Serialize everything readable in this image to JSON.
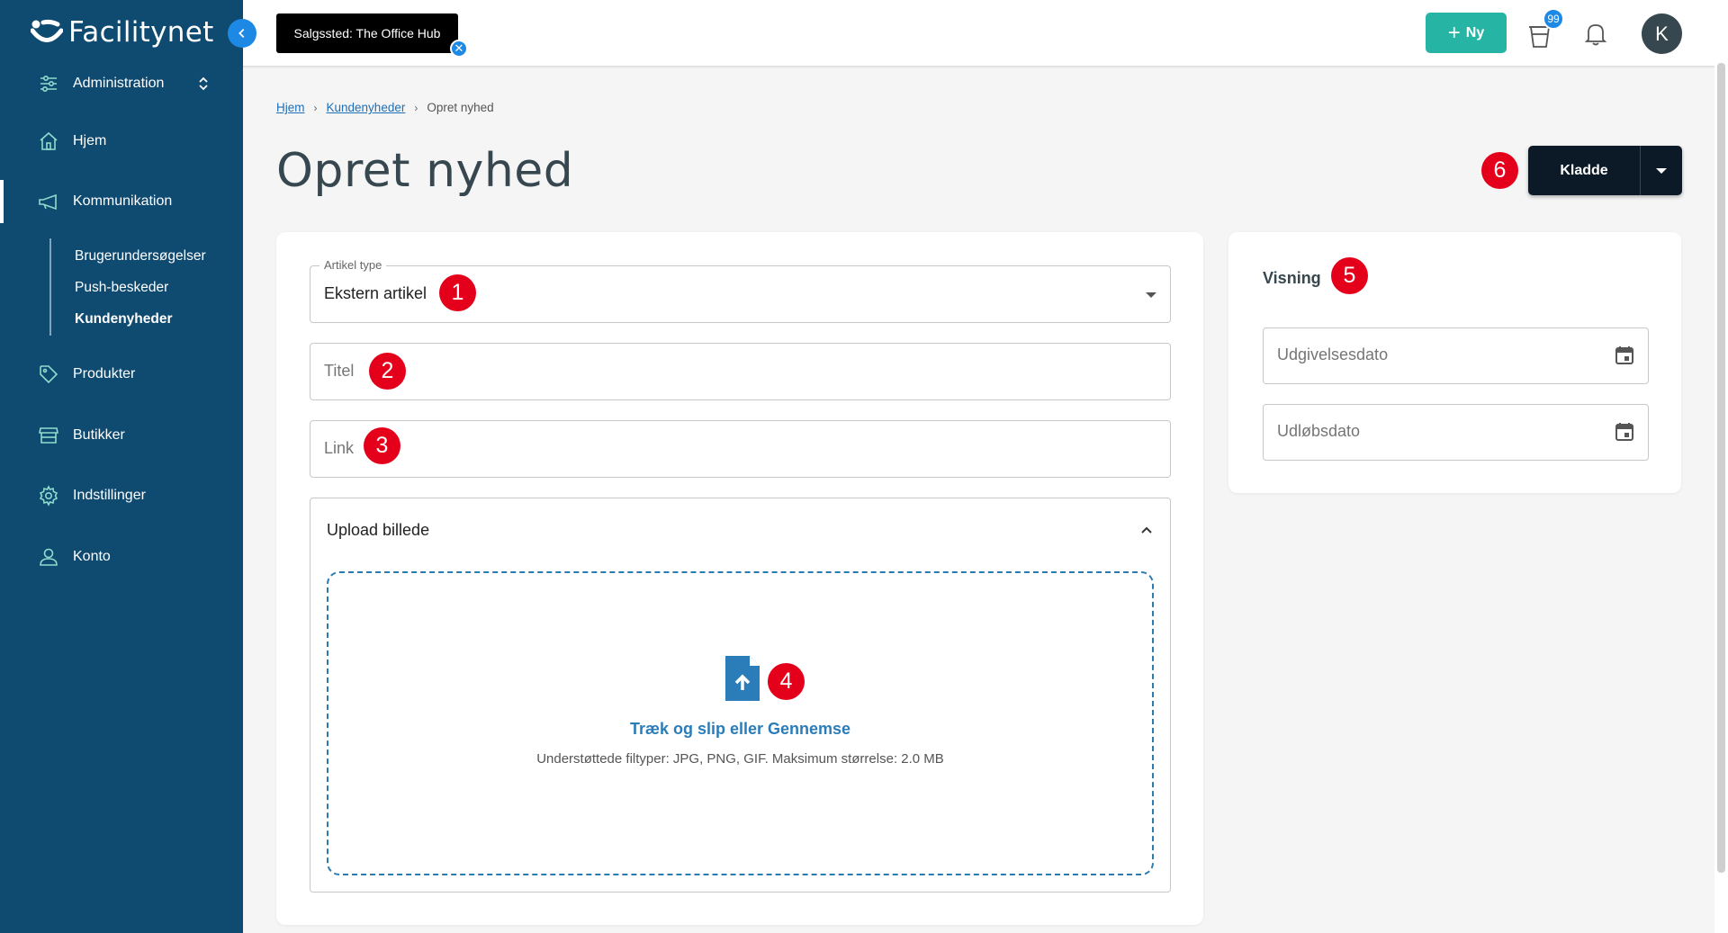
{
  "brand": {
    "name": "Facilitynet"
  },
  "sidebar": {
    "items": [
      {
        "label": "Administration",
        "icon": "sliders-icon"
      },
      {
        "label": "Hjem",
        "icon": "home-icon"
      },
      {
        "label": "Kommunikation",
        "icon": "megaphone-icon"
      },
      {
        "label": "Produkter",
        "icon": "tag-icon"
      },
      {
        "label": "Butikker",
        "icon": "store-icon"
      },
      {
        "label": "Indstillinger",
        "icon": "gear-icon"
      },
      {
        "label": "Konto",
        "icon": "user-icon"
      }
    ],
    "subitems": [
      {
        "label": "Brugerundersøgelser"
      },
      {
        "label": "Push-beskeder"
      },
      {
        "label": "Kundenyheder"
      }
    ]
  },
  "topbar": {
    "sales_point": "Salgssted: The Office Hub",
    "new_button": "Ny",
    "cart_count": "99",
    "avatar_initial": "K"
  },
  "breadcrumb": [
    "Hjem",
    "Kundenyheder",
    "Opret nyhed"
  ],
  "page_title": "Opret nyhed",
  "status_button": "Kladde",
  "form": {
    "article_type_label": "Artikel type",
    "article_type_value": "Ekstern artikel",
    "title_placeholder": "Titel",
    "link_placeholder": "Link",
    "upload_title": "Upload billede",
    "drop_text": "Træk og slip eller Gennemse",
    "drop_subtext": "Understøttede filtyper: JPG, PNG, GIF. Maksimum størrelse: 2.0 MB"
  },
  "visning": {
    "title": "Visning",
    "publish_placeholder": "Udgivelsesdato",
    "expiry_placeholder": "Udløbsdato"
  },
  "markers": [
    "1",
    "2",
    "3",
    "4",
    "5",
    "6"
  ],
  "colors": {
    "sidebar": "#0f4a70",
    "accent": "#26b5a4",
    "marker": "#e4001a",
    "link": "#1e6fb5"
  }
}
